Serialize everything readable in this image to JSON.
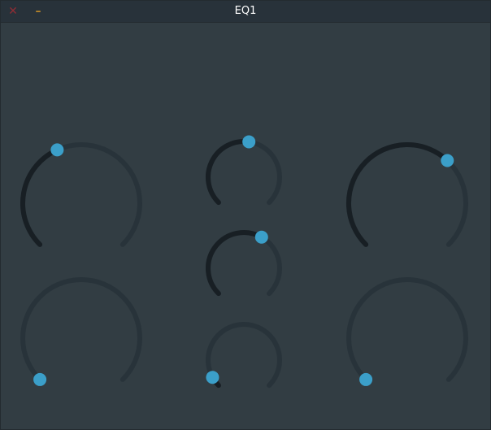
{
  "window": {
    "title": "EQ1",
    "close_icon": "close-icon",
    "minimize_icon": "minimize-icon",
    "close_glyph": "✕",
    "minimize_glyph": "–"
  },
  "colors": {
    "background": "#323d43",
    "titlebar": "#28323a",
    "track": "#28333a",
    "value_arc": "#181f24",
    "handle": "#3b9fc9",
    "close": "#8e2c34",
    "minimize": "#b8852a"
  },
  "knobs": [
    {
      "id": "knob-left-top",
      "value": 0.41
    },
    {
      "id": "knob-left-bottom",
      "value": 0.0
    },
    {
      "id": "knob-center-top",
      "value": 0.53
    },
    {
      "id": "knob-center-middle",
      "value": 0.61
    },
    {
      "id": "knob-center-bottom",
      "value": 0.06
    },
    {
      "id": "knob-right-top",
      "value": 0.66
    },
    {
      "id": "knob-right-bottom",
      "value": 0.0
    }
  ]
}
